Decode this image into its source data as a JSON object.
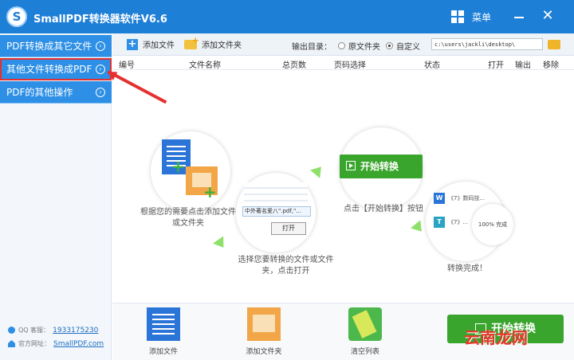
{
  "window": {
    "title": "SmallPDF转换器软件V6.6",
    "logo_letter": "S",
    "menu_label": "菜单",
    "close_glyph": "✕"
  },
  "sidebar": {
    "items": [
      {
        "label": "PDF转换成其它文件"
      },
      {
        "label": "其他文件转换成PDF"
      },
      {
        "label": "PDF的其他操作"
      }
    ],
    "chevron": "›",
    "qq_label": "QQ 客服：",
    "qq_value": "1933175230",
    "site_label": "官方网址：",
    "site_value": "SmallPDF.com"
  },
  "toolbar": {
    "add_file": "添加文件",
    "add_folder": "添加文件夹",
    "output_label": "输出目录：",
    "radio_source": "原文件夹",
    "radio_custom": "自定义",
    "output_path": "c:\\users\\jackli\\desktop\\"
  },
  "table": {
    "headers": [
      "编号",
      "文件名称",
      "总页数",
      "页码选择",
      "状态",
      "打开",
      "输出",
      "移除"
    ]
  },
  "steps": {
    "step1": "根据您的需要点击添加文件或文件夹",
    "step2": "选择您要转换的文件或文件夹，点击打开",
    "step3": "点击【开始转换】按钮",
    "step4": "转换完成！",
    "start_convert": "开始转换",
    "open_label": "打开",
    "pdf_file": "中外著名爱八\".pdf,\"...",
    "result_1": "《7》数码技...",
    "result_2": "《7》...",
    "progress_text": "100% 完成"
  },
  "bottom": {
    "add_file": "添加文件",
    "add_folder": "添加文件夹",
    "clear_list": "清空列表",
    "start": "开始转换"
  },
  "watermark": "云南龙网",
  "colors": {
    "titlebar": "#1e7fd7",
    "sidebar_item": "#2d8fe5",
    "start_green": "#3aa52d",
    "highlight_red": "#e53030"
  }
}
